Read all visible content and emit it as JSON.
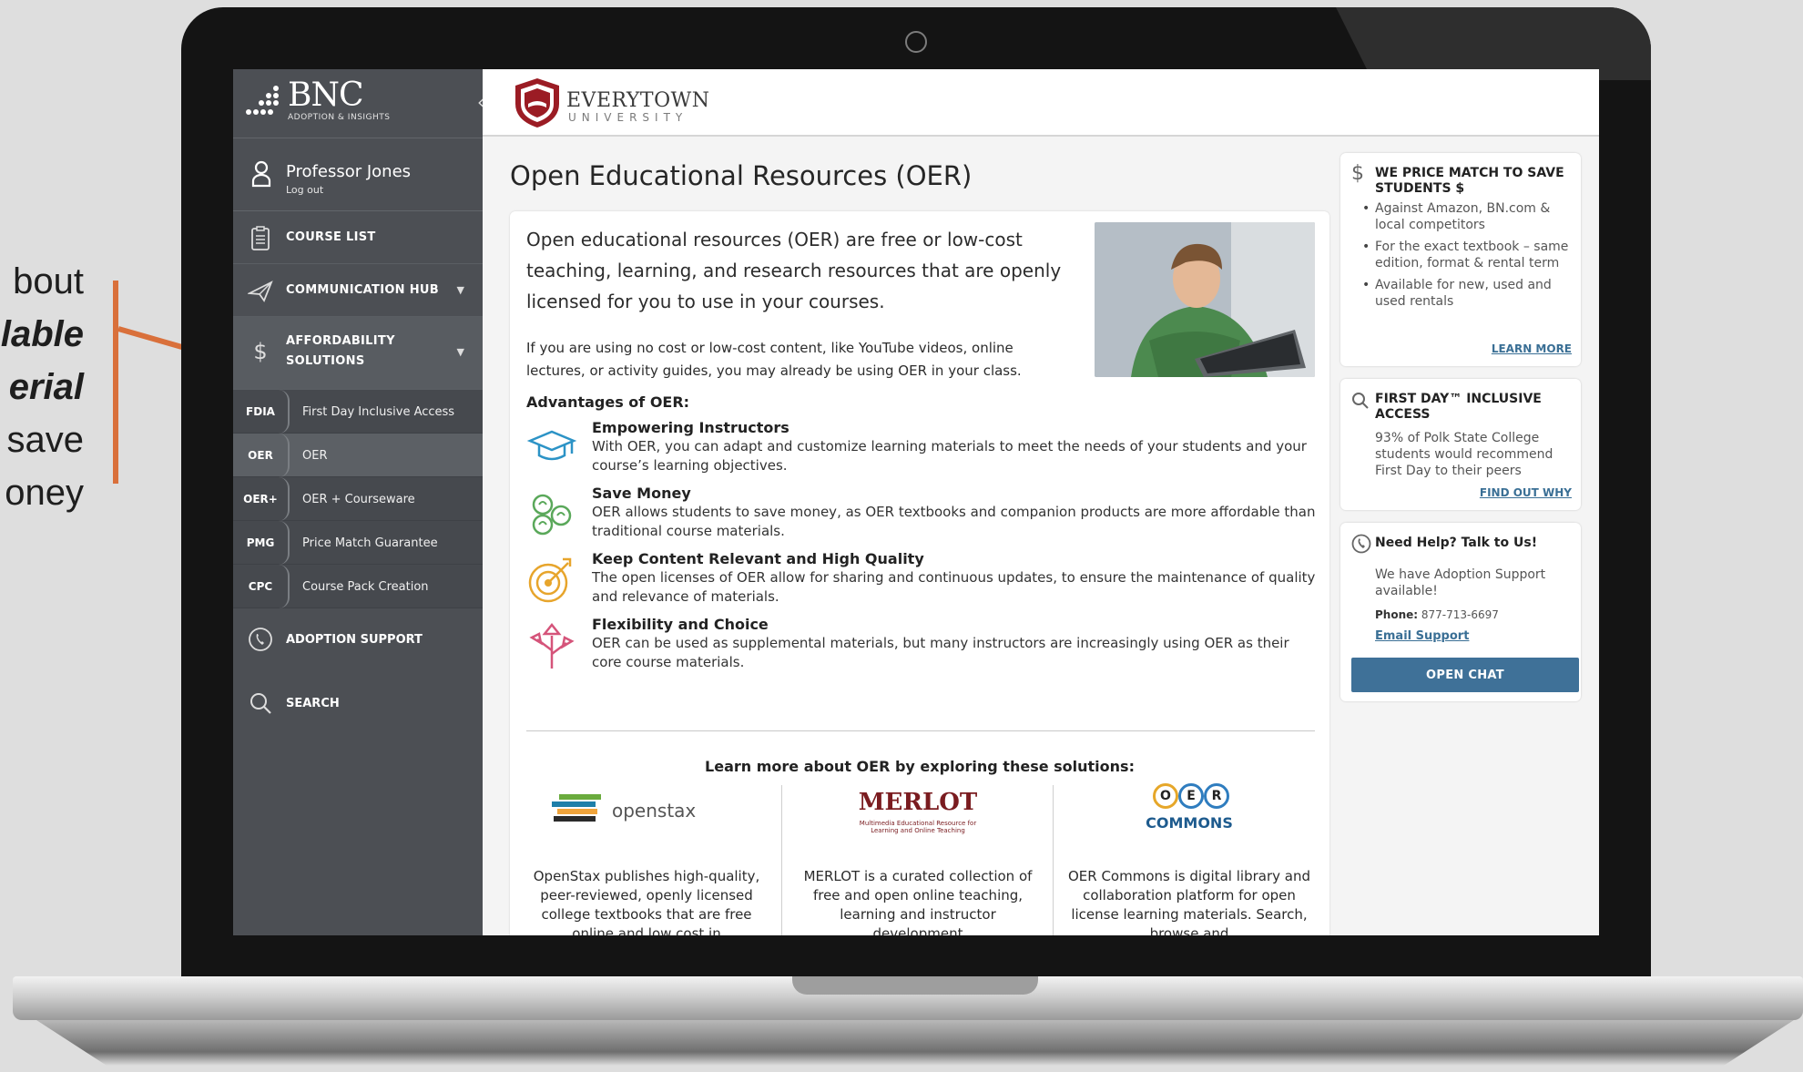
{
  "callout": {
    "line1": "bout",
    "line2": "lable",
    "line3": "erial",
    "line4": "save",
    "line5": "oney"
  },
  "sidebar": {
    "logo_text": "BNC",
    "logo_sub": "ADOPTION & INSIGHTS",
    "user_name": "Professor Jones",
    "logout": "Log out",
    "items": [
      {
        "label": "COURSE LIST",
        "icon": "clipboard-icon"
      },
      {
        "label": "COMMUNICATION HUB",
        "icon": "paper-plane-icon"
      }
    ],
    "affordability": "AFFORDABILITY SOLUTIONS",
    "affordability_l1": "AFFORDABILITY",
    "affordability_l2": "SOLUTIONS",
    "sub_items": [
      {
        "code": "FDIA",
        "label": "First Day Inclusive Access"
      },
      {
        "code": "OER",
        "label": "OER"
      },
      {
        "code": "OER+",
        "label": "OER + Courseware"
      },
      {
        "code": "PMG",
        "label": "Price Match Guarantee"
      },
      {
        "code": "CPC",
        "label": "Course Pack Creation"
      }
    ],
    "adoption_support": "ADOPTION SUPPORT",
    "search": "SEARCH"
  },
  "header": {
    "university": "EVERYTOWN",
    "university_sub": "UNIVERSITY"
  },
  "main": {
    "title": "Open Educational Resources (OER)",
    "intro": "Open educational resources (OER) are free or low-cost teaching, learning, and research resources that are openly licensed for you to use in your courses.",
    "intro2": "If you are using no cost or low-cost content, like YouTube videos, online lectures, or activity guides, you may already be using OER in your class.",
    "advantages_title": "Advantages of OER:",
    "advantages": [
      {
        "title": "Empowering Instructors",
        "desc": "With OER, you can adapt and customize learning materials to meet the needs of your students and your course’s learning objectives.",
        "icon": "graduation-cap-icon"
      },
      {
        "title": "Save Money",
        "desc": "OER allows students to save money, as OER textbooks and companion products are more affordable than traditional course materials.",
        "icon": "coins-icon"
      },
      {
        "title": "Keep Content Relevant and High Quality",
        "desc": "The open licenses of OER allow for sharing and continuous updates, to ensure the maintenance of quality and relevance of materials.",
        "icon": "target-icon"
      },
      {
        "title": "Flexibility and Choice",
        "desc": "OER can be used as supplemental materials, but many instructors are increasingly using OER as their core course materials.",
        "icon": "directions-arrows-icon"
      }
    ],
    "learn_more": "Learn more about OER by exploring these solutions:",
    "solutions": [
      {
        "name": "openstax",
        "desc": "OpenStax publishes high-quality, peer-reviewed, openly licensed college textbooks that are free online and low cost in"
      },
      {
        "name": "MERLOT",
        "sub": "Multimedia Educational Resource for Learning and Online Teaching",
        "desc": "MERLOT is a curated collection of free and open online teaching, learning and instructor development"
      },
      {
        "name": "COMMONS",
        "letters": [
          "O",
          "E",
          "R"
        ],
        "desc": "OER Commons is digital library and collaboration platform for open license learning materials. Search, browse and"
      }
    ]
  },
  "right": {
    "price_match": {
      "title": "WE PRICE MATCH TO SAVE STUDENTS $",
      "bullets": [
        "Against Amazon, BN.com & local competitors",
        "For the exact textbook – same edition, format & rental term",
        "Available for new, used and used rentals"
      ],
      "link": "LEARN MORE"
    },
    "first_day": {
      "title": "FIRST DAY™ INCLUSIVE ACCESS",
      "body": "93% of Polk State College students would recommend First Day to their peers",
      "link": "FIND OUT WHY"
    },
    "help": {
      "title": "Need Help? Talk to Us!",
      "body": "We have Adoption Support available!",
      "phone_label": "Phone:",
      "phone": "877-713-6697",
      "email": "Email Support",
      "chat": "OPEN CHAT"
    }
  }
}
